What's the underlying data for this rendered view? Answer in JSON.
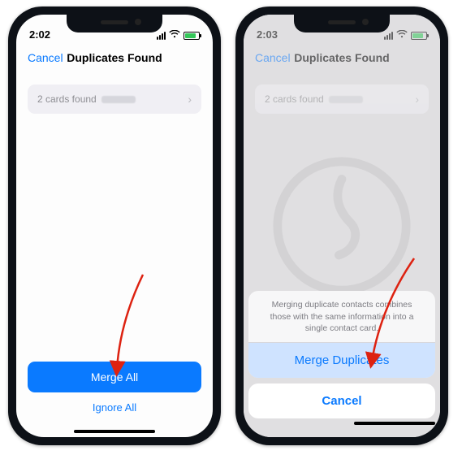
{
  "left": {
    "status_time": "2:02",
    "nav_cancel": "Cancel",
    "nav_title": "Duplicates Found",
    "cards_found": "2 cards found",
    "merge_all": "Merge All",
    "ignore_all": "Ignore All"
  },
  "right": {
    "status_time": "2:03",
    "nav_cancel": "Cancel",
    "nav_title": "Duplicates Found",
    "cards_found": "2 cards found",
    "sheet_desc": "Merging duplicate contacts combines those with the same information into a single contact card.",
    "merge_duplicates": "Merge Duplicates",
    "cancel": "Cancel"
  }
}
